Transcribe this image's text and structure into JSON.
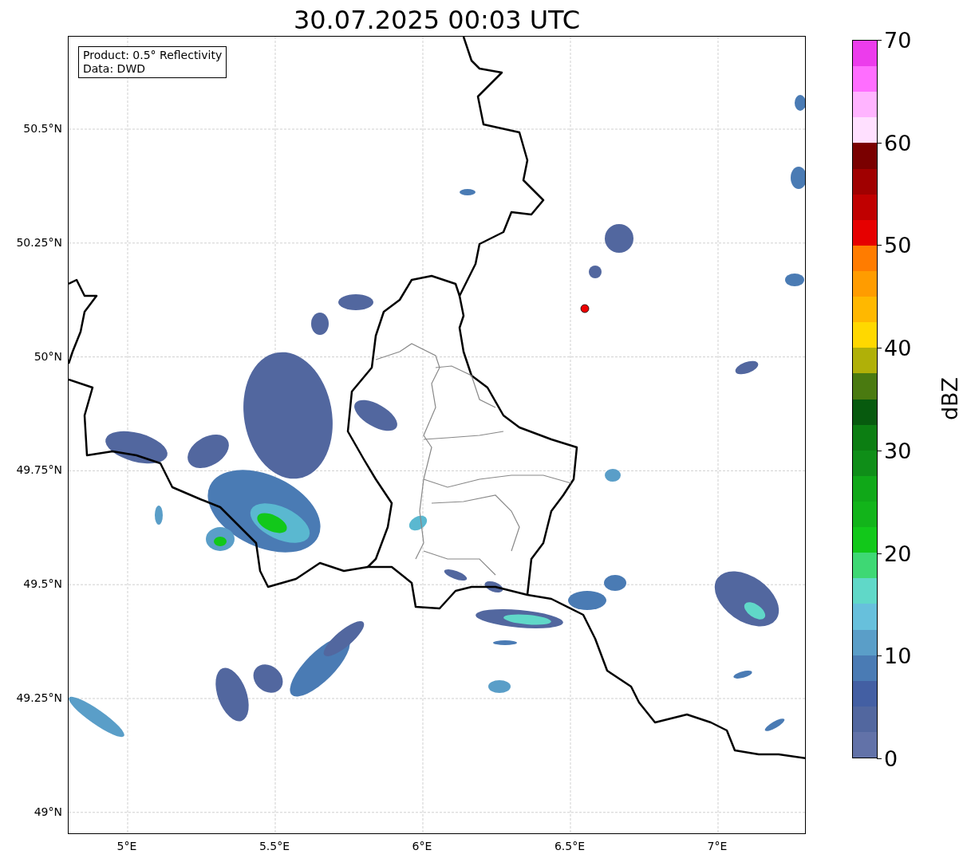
{
  "title": "30.07.2025 00:03 UTC",
  "legend": [
    "Product: 0.5° Reflectivity",
    "Data: DWD"
  ],
  "map": {
    "y_ticks": [
      "50.5°N",
      "50.25°N",
      "50°N",
      "49.75°N",
      "49.5°N",
      "49.25°N",
      "49°N"
    ],
    "x_ticks": [
      "5°E",
      "5.5°E",
      "6°E",
      "6.5°E",
      "7°E"
    ]
  },
  "colorbar": {
    "label": "dBZ",
    "ticks": [
      "70",
      "60",
      "50",
      "40",
      "30",
      "20",
      "10",
      "0"
    ],
    "bands": [
      {
        "color": "#ec3cec"
      },
      {
        "color": "#ff6eff"
      },
      {
        "color": "#ffb4ff"
      },
      {
        "color": "#ffe0ff"
      },
      {
        "color": "#7a0000"
      },
      {
        "color": "#a00000"
      },
      {
        "color": "#c00000"
      },
      {
        "color": "#e60000"
      },
      {
        "color": "#ff7c00"
      },
      {
        "color": "#ff9c00"
      },
      {
        "color": "#ffb800"
      },
      {
        "color": "#ffd800"
      },
      {
        "color": "#b0b008"
      },
      {
        "color": "#4a7a10"
      },
      {
        "color": "#075a0e"
      },
      {
        "color": "#0c7e12"
      },
      {
        "color": "#0f8e18"
      },
      {
        "color": "#10a818"
      },
      {
        "color": "#12b41a"
      },
      {
        "color": "#12c81a"
      },
      {
        "color": "#3ed874"
      },
      {
        "color": "#60d8c8"
      },
      {
        "color": "#67c0dc"
      },
      {
        "color": "#5a9ec8"
      },
      {
        "color": "#4a7bb4"
      },
      {
        "color": "#435fa3"
      },
      {
        "color": "#52679f"
      },
      {
        "color": "#6272a8"
      }
    ]
  }
}
